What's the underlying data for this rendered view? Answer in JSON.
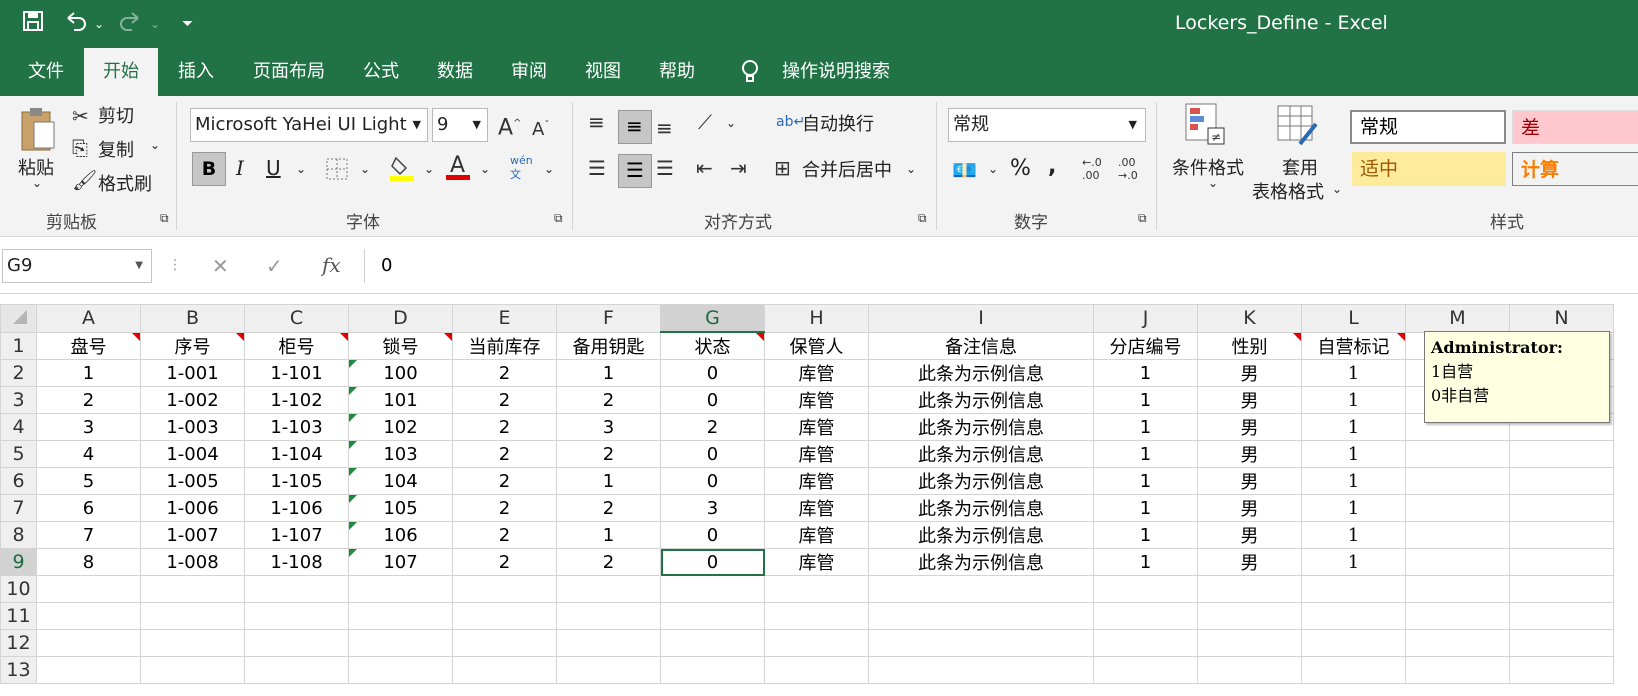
{
  "titlebar": {
    "title": "Lockers_Define  -  Excel",
    "save_icon": "save-icon",
    "undo_icon": "undo-icon",
    "redo_icon": "redo-icon"
  },
  "tabs": [
    "文件",
    "开始",
    "插入",
    "页面布局",
    "公式",
    "数据",
    "审阅",
    "视图",
    "帮助"
  ],
  "tell_me": "操作说明搜索",
  "ribbon": {
    "clipboard": {
      "paste": "粘贴",
      "cut": "剪切",
      "copy": "复制",
      "format_painter": "格式刷",
      "label": "剪贴板"
    },
    "font": {
      "name": "Microsoft YaHei UI Light",
      "size": "9",
      "bold": "B",
      "italic": "I",
      "underline": "U",
      "label": "字体",
      "phonetic": "wén\n文"
    },
    "alignment": {
      "wrap": "自动换行",
      "merge": "合并后居中",
      "label": "对齐方式"
    },
    "number": {
      "format": "常规",
      "percent": "%",
      "comma": ",",
      "label": "数字"
    },
    "styles": {
      "conditional": "条件格式",
      "table_l1": "套用",
      "table_l2": "表格格式",
      "label": "样式",
      "normal": "常规",
      "bad": "差",
      "neutral": "适中",
      "calc": "计算"
    }
  },
  "formula_bar": {
    "name_box": "G9",
    "value": "0",
    "fx": "fx"
  },
  "columns": [
    "A",
    "B",
    "C",
    "D",
    "E",
    "F",
    "G",
    "H",
    "I",
    "J",
    "K",
    "L",
    "M",
    "N"
  ],
  "selected_column": "G",
  "selected_row": 9,
  "headers": [
    "盘号",
    "序号",
    "柜号",
    "锁号",
    "当前库存",
    "备用钥匙",
    "状态",
    "保管人",
    "备注信息",
    "分店编号",
    "性别",
    "自营标记"
  ],
  "rows": [
    [
      "1",
      "1-001",
      "1-101",
      "100",
      "2",
      "1",
      "0",
      "库管",
      "此条为示例信息",
      "1",
      "男",
      "1"
    ],
    [
      "2",
      "1-002",
      "1-102",
      "101",
      "2",
      "2",
      "0",
      "库管",
      "此条为示例信息",
      "1",
      "男",
      "1"
    ],
    [
      "3",
      "1-003",
      "1-103",
      "102",
      "2",
      "3",
      "2",
      "库管",
      "此条为示例信息",
      "1",
      "男",
      "1"
    ],
    [
      "4",
      "1-004",
      "1-104",
      "103",
      "2",
      "2",
      "0",
      "库管",
      "此条为示例信息",
      "1",
      "男",
      "1"
    ],
    [
      "5",
      "1-005",
      "1-105",
      "104",
      "2",
      "1",
      "0",
      "库管",
      "此条为示例信息",
      "1",
      "男",
      "1"
    ],
    [
      "6",
      "1-006",
      "1-106",
      "105",
      "2",
      "2",
      "3",
      "库管",
      "此条为示例信息",
      "1",
      "男",
      "1"
    ],
    [
      "7",
      "1-007",
      "1-107",
      "106",
      "2",
      "1",
      "0",
      "库管",
      "此条为示例信息",
      "1",
      "男",
      "1"
    ],
    [
      "8",
      "1-008",
      "1-108",
      "107",
      "2",
      "2",
      "0",
      "库管",
      "此条为示例信息",
      "1",
      "男",
      "1"
    ]
  ],
  "row_numbers": [
    "1",
    "2",
    "3",
    "4",
    "5",
    "6",
    "7",
    "8",
    "9",
    "10",
    "11",
    "12",
    "13"
  ],
  "comment": {
    "author": "Administrator:",
    "line1": "1自营",
    "line2": "0非自营"
  },
  "colors": {
    "accent": "#217346",
    "bad_bg": "#ffc7ce",
    "bad_fg": "#9c0006",
    "neutral_bg": "#ffeb9c",
    "neutral_fg": "#9c5700",
    "calc_fg": "#fa7d00"
  }
}
